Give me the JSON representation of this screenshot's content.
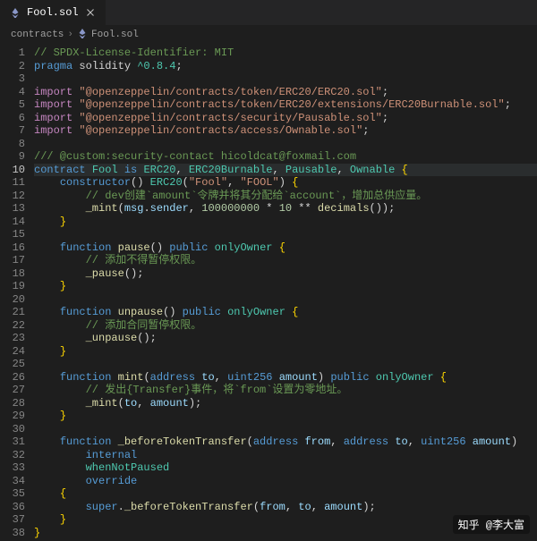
{
  "tab": {
    "filename": "Fool.sol",
    "dirty": false
  },
  "breadcrumbs": {
    "folder": "contracts",
    "file": "Fool.sol"
  },
  "code": {
    "lines": [
      {
        "n": 1,
        "t": "// SPDX-License-Identifier: MIT",
        "cls": "comment"
      },
      {
        "n": 2,
        "tokens": [
          [
            "pragma",
            "keyword"
          ],
          [
            " solidity",
            "punct"
          ],
          [
            " ^0.8.4",
            "type"
          ],
          [
            ";",
            "punct"
          ]
        ]
      },
      {
        "n": 3,
        "blank": true
      },
      {
        "n": 4,
        "tokens": [
          [
            "import",
            "keyword2"
          ],
          [
            " ",
            "punct"
          ],
          [
            "\"@openzeppelin/contracts/token/ERC20/ERC20.sol\"",
            "string"
          ],
          [
            ";",
            "punct"
          ]
        ]
      },
      {
        "n": 5,
        "tokens": [
          [
            "import",
            "keyword2"
          ],
          [
            " ",
            "punct"
          ],
          [
            "\"@openzeppelin/contracts/token/ERC20/extensions/ERC20Burnable.sol\"",
            "string"
          ],
          [
            ";",
            "punct"
          ]
        ]
      },
      {
        "n": 6,
        "tokens": [
          [
            "import",
            "keyword2"
          ],
          [
            " ",
            "punct"
          ],
          [
            "\"@openzeppelin/contracts/security/Pausable.sol\"",
            "string"
          ],
          [
            ";",
            "punct"
          ]
        ]
      },
      {
        "n": 7,
        "tokens": [
          [
            "import",
            "keyword2"
          ],
          [
            " ",
            "punct"
          ],
          [
            "\"@openzeppelin/contracts/access/Ownable.sol\"",
            "string"
          ],
          [
            ";",
            "punct"
          ]
        ]
      },
      {
        "n": 8,
        "blank": true
      },
      {
        "n": 9,
        "t": "/// @custom:security-contact hicoldcat@foxmail.com",
        "cls": "comment"
      },
      {
        "n": 10,
        "hl": true,
        "tokens": [
          [
            "contract",
            "keyword"
          ],
          [
            " ",
            "punct"
          ],
          [
            "Fool",
            "type"
          ],
          [
            " ",
            "punct"
          ],
          [
            "is",
            "keyword"
          ],
          [
            " ",
            "punct"
          ],
          [
            "ERC20",
            "type"
          ],
          [
            ", ",
            "punct"
          ],
          [
            "ERC20Burnable",
            "type"
          ],
          [
            ", ",
            "punct"
          ],
          [
            "Pausable",
            "type"
          ],
          [
            ", ",
            "punct"
          ],
          [
            "Ownable",
            "type"
          ],
          [
            " ",
            "punct"
          ],
          [
            "{",
            "brace"
          ]
        ]
      },
      {
        "n": 11,
        "indent": 4,
        "tokens": [
          [
            "constructor",
            "keyword"
          ],
          [
            "()",
            "punct"
          ],
          [
            " ",
            "punct"
          ],
          [
            "ERC20",
            "type"
          ],
          [
            "(",
            "punct"
          ],
          [
            "\"Fool\"",
            "string"
          ],
          [
            ", ",
            "punct"
          ],
          [
            "\"FOOL\"",
            "string"
          ],
          [
            ")",
            "punct"
          ],
          [
            " ",
            "punct"
          ],
          [
            "{",
            "brace"
          ]
        ]
      },
      {
        "n": 12,
        "indent": 8,
        "t": "// dev创建`amount`令牌并将其分配给`account`，增加总供应量。",
        "cls": "comment"
      },
      {
        "n": 13,
        "indent": 8,
        "tokens": [
          [
            "_mint",
            "func"
          ],
          [
            "(",
            "punct"
          ],
          [
            "msg",
            "param"
          ],
          [
            ".",
            "punct"
          ],
          [
            "sender",
            "param"
          ],
          [
            ", ",
            "punct"
          ],
          [
            "100000000",
            "number"
          ],
          [
            " * ",
            "punct"
          ],
          [
            "10",
            "number"
          ],
          [
            " ** ",
            "punct"
          ],
          [
            "decimals",
            "func"
          ],
          [
            "());",
            "punct"
          ]
        ]
      },
      {
        "n": 14,
        "indent": 4,
        "tokens": [
          [
            "}",
            "brace"
          ]
        ]
      },
      {
        "n": 15,
        "blank": true
      },
      {
        "n": 16,
        "indent": 4,
        "tokens": [
          [
            "function",
            "keyword"
          ],
          [
            " ",
            "punct"
          ],
          [
            "pause",
            "func"
          ],
          [
            "()",
            "punct"
          ],
          [
            " ",
            "punct"
          ],
          [
            "public",
            "keyword"
          ],
          [
            " ",
            "punct"
          ],
          [
            "onlyOwner",
            "type"
          ],
          [
            " ",
            "punct"
          ],
          [
            "{",
            "brace"
          ]
        ]
      },
      {
        "n": 17,
        "indent": 8,
        "t": "// 添加不得暂停权限。",
        "cls": "comment"
      },
      {
        "n": 18,
        "indent": 8,
        "tokens": [
          [
            "_pause",
            "func"
          ],
          [
            "();",
            "punct"
          ]
        ]
      },
      {
        "n": 19,
        "indent": 4,
        "tokens": [
          [
            "}",
            "brace"
          ]
        ]
      },
      {
        "n": 20,
        "blank": true
      },
      {
        "n": 21,
        "indent": 4,
        "tokens": [
          [
            "function",
            "keyword"
          ],
          [
            " ",
            "punct"
          ],
          [
            "unpause",
            "func"
          ],
          [
            "()",
            "punct"
          ],
          [
            " ",
            "punct"
          ],
          [
            "public",
            "keyword"
          ],
          [
            " ",
            "punct"
          ],
          [
            "onlyOwner",
            "type"
          ],
          [
            " ",
            "punct"
          ],
          [
            "{",
            "brace"
          ]
        ]
      },
      {
        "n": 22,
        "indent": 8,
        "t": "// 添加合同暂停权限。",
        "cls": "comment"
      },
      {
        "n": 23,
        "indent": 8,
        "tokens": [
          [
            "_unpause",
            "func"
          ],
          [
            "();",
            "punct"
          ]
        ]
      },
      {
        "n": 24,
        "indent": 4,
        "tokens": [
          [
            "}",
            "brace"
          ]
        ]
      },
      {
        "n": 25,
        "blank": true
      },
      {
        "n": 26,
        "indent": 4,
        "tokens": [
          [
            "function",
            "keyword"
          ],
          [
            " ",
            "punct"
          ],
          [
            "mint",
            "func"
          ],
          [
            "(",
            "punct"
          ],
          [
            "address",
            "keyword"
          ],
          [
            " ",
            "punct"
          ],
          [
            "to",
            "param"
          ],
          [
            ", ",
            "punct"
          ],
          [
            "uint256",
            "keyword"
          ],
          [
            " ",
            "punct"
          ],
          [
            "amount",
            "param"
          ],
          [
            ")",
            "punct"
          ],
          [
            " ",
            "punct"
          ],
          [
            "public",
            "keyword"
          ],
          [
            " ",
            "punct"
          ],
          [
            "onlyOwner",
            "type"
          ],
          [
            " ",
            "punct"
          ],
          [
            "{",
            "brace"
          ]
        ]
      },
      {
        "n": 27,
        "indent": 8,
        "t": "// 发出{Transfer}事件，将`from`设置为零地址。",
        "cls": "comment"
      },
      {
        "n": 28,
        "indent": 8,
        "tokens": [
          [
            "_mint",
            "func"
          ],
          [
            "(",
            "punct"
          ],
          [
            "to",
            "param"
          ],
          [
            ", ",
            "punct"
          ],
          [
            "amount",
            "param"
          ],
          [
            ");",
            "punct"
          ]
        ]
      },
      {
        "n": 29,
        "indent": 4,
        "tokens": [
          [
            "}",
            "brace"
          ]
        ]
      },
      {
        "n": 30,
        "blank": true
      },
      {
        "n": 31,
        "indent": 4,
        "tokens": [
          [
            "function",
            "keyword"
          ],
          [
            " ",
            "punct"
          ],
          [
            "_beforeTokenTransfer",
            "func"
          ],
          [
            "(",
            "punct"
          ],
          [
            "address",
            "keyword"
          ],
          [
            " ",
            "punct"
          ],
          [
            "from",
            "param"
          ],
          [
            ", ",
            "punct"
          ],
          [
            "address",
            "keyword"
          ],
          [
            " ",
            "punct"
          ],
          [
            "to",
            "param"
          ],
          [
            ", ",
            "punct"
          ],
          [
            "uint256",
            "keyword"
          ],
          [
            " ",
            "punct"
          ],
          [
            "amount",
            "param"
          ],
          [
            ")",
            "punct"
          ]
        ]
      },
      {
        "n": 32,
        "indent": 8,
        "tokens": [
          [
            "internal",
            "keyword"
          ]
        ]
      },
      {
        "n": 33,
        "indent": 8,
        "tokens": [
          [
            "whenNotPaused",
            "type"
          ]
        ]
      },
      {
        "n": 34,
        "indent": 8,
        "tokens": [
          [
            "override",
            "keyword"
          ]
        ]
      },
      {
        "n": 35,
        "indent": 4,
        "tokens": [
          [
            "{",
            "brace"
          ]
        ]
      },
      {
        "n": 36,
        "indent": 8,
        "tokens": [
          [
            "super",
            "keyword"
          ],
          [
            ".",
            "punct"
          ],
          [
            "_beforeTokenTransfer",
            "func"
          ],
          [
            "(",
            "punct"
          ],
          [
            "from",
            "param"
          ],
          [
            ", ",
            "punct"
          ],
          [
            "to",
            "param"
          ],
          [
            ", ",
            "punct"
          ],
          [
            "amount",
            "param"
          ],
          [
            ");",
            "punct"
          ]
        ]
      },
      {
        "n": 37,
        "indent": 4,
        "tokens": [
          [
            "}",
            "brace"
          ]
        ]
      },
      {
        "n": 38,
        "tokens": [
          [
            "}",
            "brace"
          ]
        ]
      }
    ]
  },
  "watermark": "知乎 @李大富"
}
